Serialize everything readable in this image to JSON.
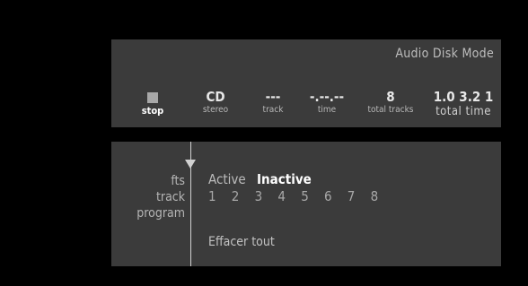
{
  "status": {
    "mode_title": "Audio Disk Mode",
    "stop": {
      "label": "stop"
    },
    "disc": {
      "value": "CD",
      "label": "stereo"
    },
    "track": {
      "value": "---",
      "label": "track"
    },
    "time": {
      "value": "-.--.--",
      "label": "time"
    },
    "total_tracks": {
      "value": "8",
      "label": "total tracks"
    },
    "total_time": {
      "value": "1.0 3.2 1",
      "label": "total time"
    }
  },
  "controls": {
    "labels": {
      "fts": "fts",
      "track": "track",
      "program": "program"
    },
    "fts_options": [
      "Active",
      "Inactive"
    ],
    "fts_selected": "Inactive",
    "tracks": [
      "1",
      "2",
      "3",
      "4",
      "5",
      "6",
      "7",
      "8"
    ],
    "clear_all": "Effacer tout"
  },
  "colors": {
    "background": "#000000",
    "panel": "#3b3b3b",
    "text_dim": "#b5b5b5",
    "text_bright": "#ffffff"
  },
  "icons": {
    "stop": "stop-square-icon",
    "pointer": "arrow-down-icon"
  }
}
